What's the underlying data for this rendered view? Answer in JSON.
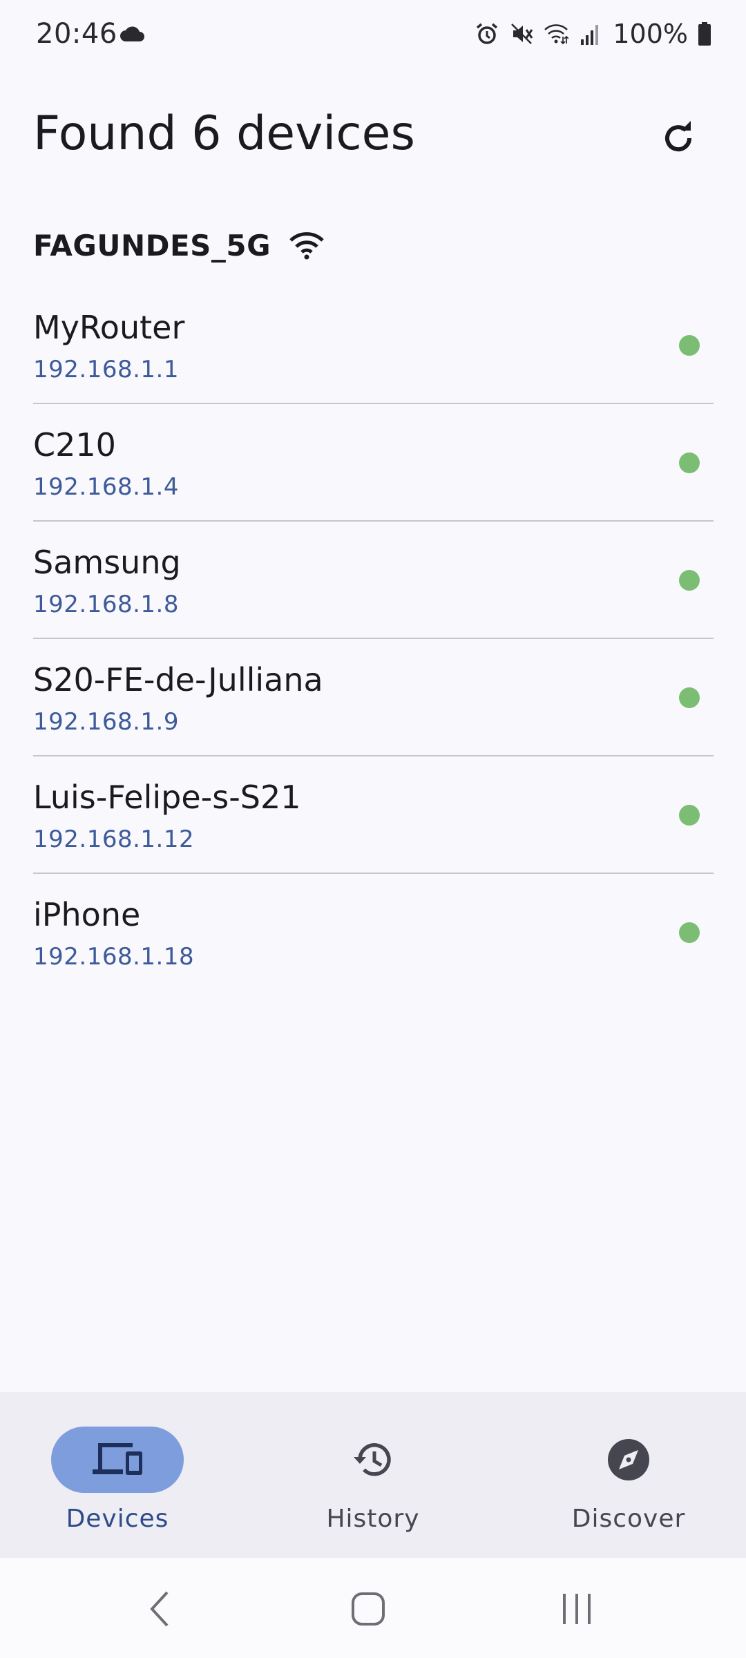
{
  "status_bar": {
    "time": "20:46",
    "battery": "100%",
    "icons": [
      "cloud-icon",
      "alarm-icon",
      "mute-icon",
      "wifi-icon",
      "signal-icon",
      "battery-icon"
    ]
  },
  "header": {
    "title": "Found 6 devices",
    "refresh_icon": "refresh-icon"
  },
  "network": {
    "ssid": "FAGUNDES_5G",
    "icon": "wifi-icon"
  },
  "devices": [
    {
      "name": "MyRouter",
      "ip": "192.168.1.1",
      "status": "online"
    },
    {
      "name": "C210",
      "ip": "192.168.1.4",
      "status": "online"
    },
    {
      "name": "Samsung",
      "ip": "192.168.1.8",
      "status": "online"
    },
    {
      "name": "S20-FE-de-Julliana",
      "ip": "192.168.1.9",
      "status": "online"
    },
    {
      "name": "Luis-Felipe-s-S21",
      "ip": "192.168.1.12",
      "status": "online"
    },
    {
      "name": "iPhone",
      "ip": "192.168.1.18",
      "status": "online"
    }
  ],
  "bottom_nav": {
    "items": [
      {
        "label": "Devices",
        "icon": "devices-icon",
        "active": true
      },
      {
        "label": "History",
        "icon": "history-icon",
        "active": false
      },
      {
        "label": "Discover",
        "icon": "compass-icon",
        "active": false
      }
    ]
  },
  "colors": {
    "background": "#f8f8fd",
    "accent": "#7d9ddc",
    "ip_text": "#3d5a99",
    "online_dot": "#7cbd74",
    "nav_background": "#ededf3"
  }
}
